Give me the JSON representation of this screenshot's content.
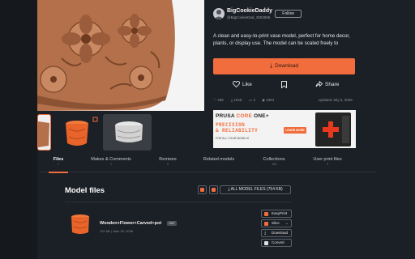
{
  "author": {
    "name": "BigCookieDaddy",
    "handle": "@BigCookieDad_3053565",
    "follow_label": "Follow"
  },
  "description": "A clean and easy-to-print vase model, perfect for home decor, plants, or display use. The model can be scaled freely to",
  "download": {
    "label": "Download",
    "icon": "download-icon"
  },
  "actions": {
    "like_label": "Like",
    "bookmark_icon": "bookmark-icon",
    "share_label": "Share"
  },
  "stats": {
    "likes": "496",
    "downloads": "1548",
    "comments": "2",
    "views": "4364",
    "updated": "updated July 6, 2026"
  },
  "ad": {
    "brand_1": "PRUSA",
    "brand_2": "CORE",
    "brand_3": "ONE+",
    "tagline_1": "PRECISION",
    "tagline_2": "& RELIABILITY",
    "sub": "FOR ALL YOUR MODELS",
    "cta": "LEARN MORE"
  },
  "tabs": [
    {
      "label": "Files",
      "count": "1"
    },
    {
      "label": "Makes & Comments",
      "count": "1"
    },
    {
      "label": "Remixes",
      "count": "0"
    },
    {
      "label": "Related models",
      "count": ""
    },
    {
      "label": "Collections",
      "count": "140"
    },
    {
      "label": "User print files",
      "count": "0"
    }
  ],
  "model_files": {
    "title": "Model files",
    "all_files_label": "⤓ ALL MODEL FILES (754 KB)"
  },
  "file": {
    "name": "Wooden+Flower+Carved+pot",
    "badge": "3MF",
    "meta": "137 kB  |  June 20, 2026",
    "buttons": {
      "easyprint": "EasyPrint",
      "slice": "Slice",
      "download": "Download",
      "convert": "Convert"
    }
  },
  "colors": {
    "accent": "#f26d3d",
    "background": "#1b1f26"
  }
}
